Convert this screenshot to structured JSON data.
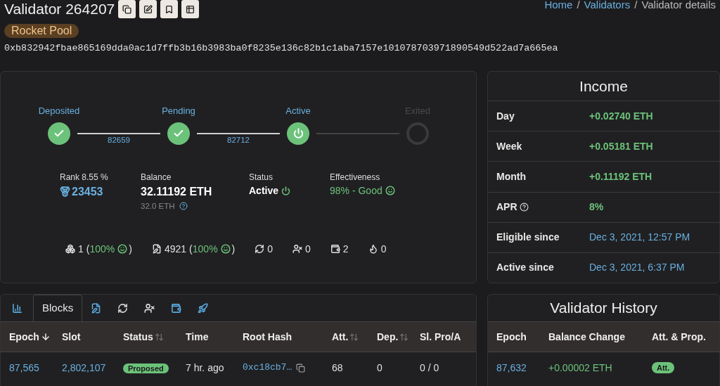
{
  "header": {
    "title": "Validator 264207",
    "tag": "Rocket Pool",
    "pubkey": "0xb832942fbae865169dda0ac1d7ffb3b16b3983ba0f8235e136c82b1c1aba7157e101078703971890549d522ad7a665ea",
    "actions": [
      {
        "kind": "copy"
      },
      {
        "kind": "edit"
      },
      {
        "kind": "bookmark"
      },
      {
        "kind": "table"
      }
    ],
    "breadcrumbs": [
      {
        "label": "Home",
        "kind": "link"
      },
      {
        "label": "/",
        "kind": "separator"
      },
      {
        "label": "Validators",
        "kind": "link"
      },
      {
        "label": "/",
        "kind": "separator"
      },
      {
        "label": "Validator details",
        "kind": "current"
      }
    ]
  },
  "stages": [
    {
      "label": "Deposited",
      "kind": "done",
      "connector_label": "82659"
    },
    {
      "label": "Pending",
      "kind": "done",
      "connector_label": "82712"
    },
    {
      "label": "Active",
      "kind": "current"
    },
    {
      "label": "Exited",
      "kind": "upcoming"
    }
  ],
  "stats": {
    "rank_label": "Rank 8.55 %",
    "rank": "23453",
    "balance_label": "Balance",
    "balance": "32.11192 ETH",
    "effective_balance": "32.0 ETH",
    "status_label": "Status",
    "status": "Active",
    "effectiveness_label": "Effectiveness",
    "effectiveness": "98% - Good"
  },
  "counters": [
    {
      "kind": "proposals",
      "count": "1",
      "open": "(",
      "pct": "100%",
      "close": ")"
    },
    {
      "kind": "attestations",
      "count": "4921",
      "open": "(",
      "pct": "100%",
      "close": ")"
    },
    {
      "kind": "sync",
      "count": "0"
    },
    {
      "kind": "slashings",
      "count": "0"
    },
    {
      "kind": "deposits",
      "count": "2"
    },
    {
      "kind": "burn",
      "count": "0"
    }
  ],
  "income": {
    "title": "Income",
    "rows": [
      {
        "label": "Day",
        "value": "+0.02740 ETH",
        "kind": "amount"
      },
      {
        "label": "Week",
        "value": "+0.05181 ETH",
        "kind": "amount"
      },
      {
        "label": "Month",
        "value": "+0.11192 ETH",
        "kind": "amount"
      },
      {
        "label": "APR",
        "value": "8%",
        "kind": "amount",
        "help": true
      },
      {
        "label": "Eligible since",
        "value": "Dec 3, 2021, 12:57 PM",
        "kind": "date"
      },
      {
        "label": "Active since",
        "value": "Dec 3, 2021, 6:37 PM",
        "kind": "date"
      }
    ]
  },
  "tabs": [
    {
      "kind": "chart",
      "selected": false
    },
    {
      "kind": "blocks",
      "label": "Blocks",
      "selected": true
    },
    {
      "kind": "attestations",
      "selected": false
    },
    {
      "kind": "sync",
      "selected": false
    },
    {
      "kind": "slashings",
      "selected": false
    },
    {
      "kind": "deposits",
      "selected": false
    },
    {
      "kind": "rocket",
      "selected": false
    }
  ],
  "blocks_table": {
    "columns": [
      {
        "label": "Epoch",
        "sortable": true,
        "sorted": true
      },
      {
        "label": "Slot",
        "sortable": false,
        "sorted": false
      },
      {
        "label": "Status",
        "sortable": true,
        "sorted": false
      },
      {
        "label": "Time",
        "sortable": false,
        "sorted": false
      },
      {
        "label": "Root Hash",
        "sortable": false,
        "sorted": false
      },
      {
        "label": "Att.",
        "sortable": true,
        "sorted": false
      },
      {
        "label": "Dep.",
        "sortable": true,
        "sorted": false
      },
      {
        "label": "Sl. Pro/A",
        "sortable": false,
        "sorted": false
      }
    ],
    "rows": [
      {
        "epoch": "87,565",
        "slot": "2,802,107",
        "status": "Proposed",
        "time": "7 hr. ago",
        "root_hash": "0xc18cb7…",
        "att": "68",
        "dep": "0",
        "sl": "0 / 0"
      }
    ]
  },
  "history": {
    "title": "Validator History",
    "columns": [
      "Epoch",
      "Balance Change",
      "Att. & Prop."
    ],
    "rows": [
      {
        "epoch": "87,632",
        "balance_change": "+0.00002 ETH",
        "duty": "Att."
      }
    ]
  }
}
